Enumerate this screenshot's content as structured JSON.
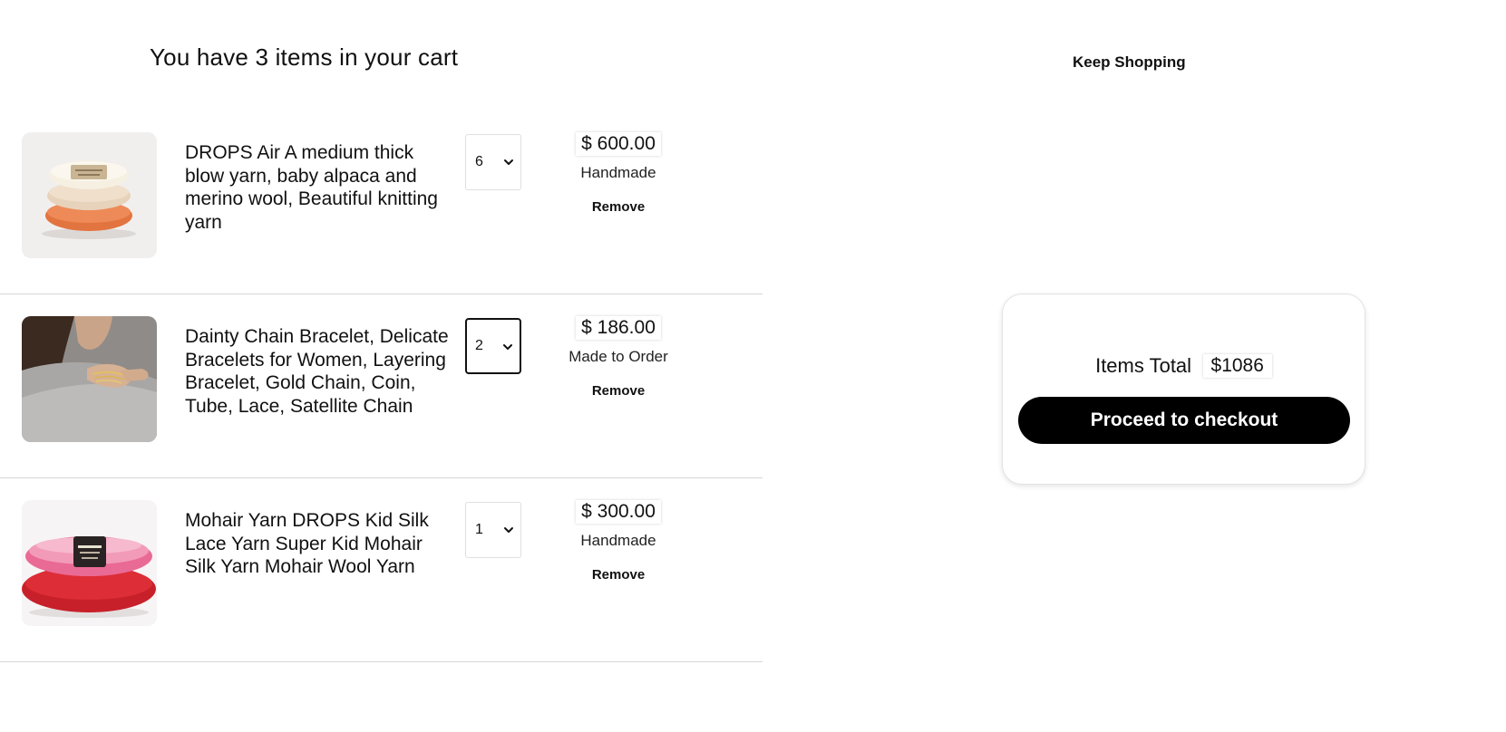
{
  "header": {
    "cart_title": "You have 3 items in your cart",
    "keep_shopping_label": "Keep Shopping"
  },
  "cart": {
    "items": [
      {
        "title": "DROPS Air A medium thick blow yarn, baby alpaca and merino wool, Beautiful knitting yarn",
        "quantity": "6",
        "price": "$ 600.00",
        "availability": "Handmade",
        "remove_label": "Remove",
        "image": "yarn-stack-cream-peach-orange"
      },
      {
        "title": "Dainty Chain Bracelet, Delicate Bracelets for Women, Layering Bracelet, Gold Chain, Coin, Tube, Lace, Satellite Chain",
        "quantity": "2",
        "price": "$ 186.00",
        "availability": "Made to Order",
        "remove_label": "Remove",
        "image": "gold-bracelets-on-wrist"
      },
      {
        "title": "Mohair Yarn DROPS Kid Silk Lace Yarn Super Kid Mohair Silk Yarn Mohair Wool Yarn",
        "quantity": "1",
        "price": "$ 300.00",
        "availability": "Handmade",
        "remove_label": "Remove",
        "image": "pink-red-mohair-yarn"
      }
    ]
  },
  "summary": {
    "items_total_label": "Items Total",
    "items_total_value": "$1086",
    "checkout_label": "Proceed to checkout"
  },
  "colors": {
    "checkout_button": "#000000",
    "divider": "#d6d6d6",
    "text": "#111111"
  }
}
